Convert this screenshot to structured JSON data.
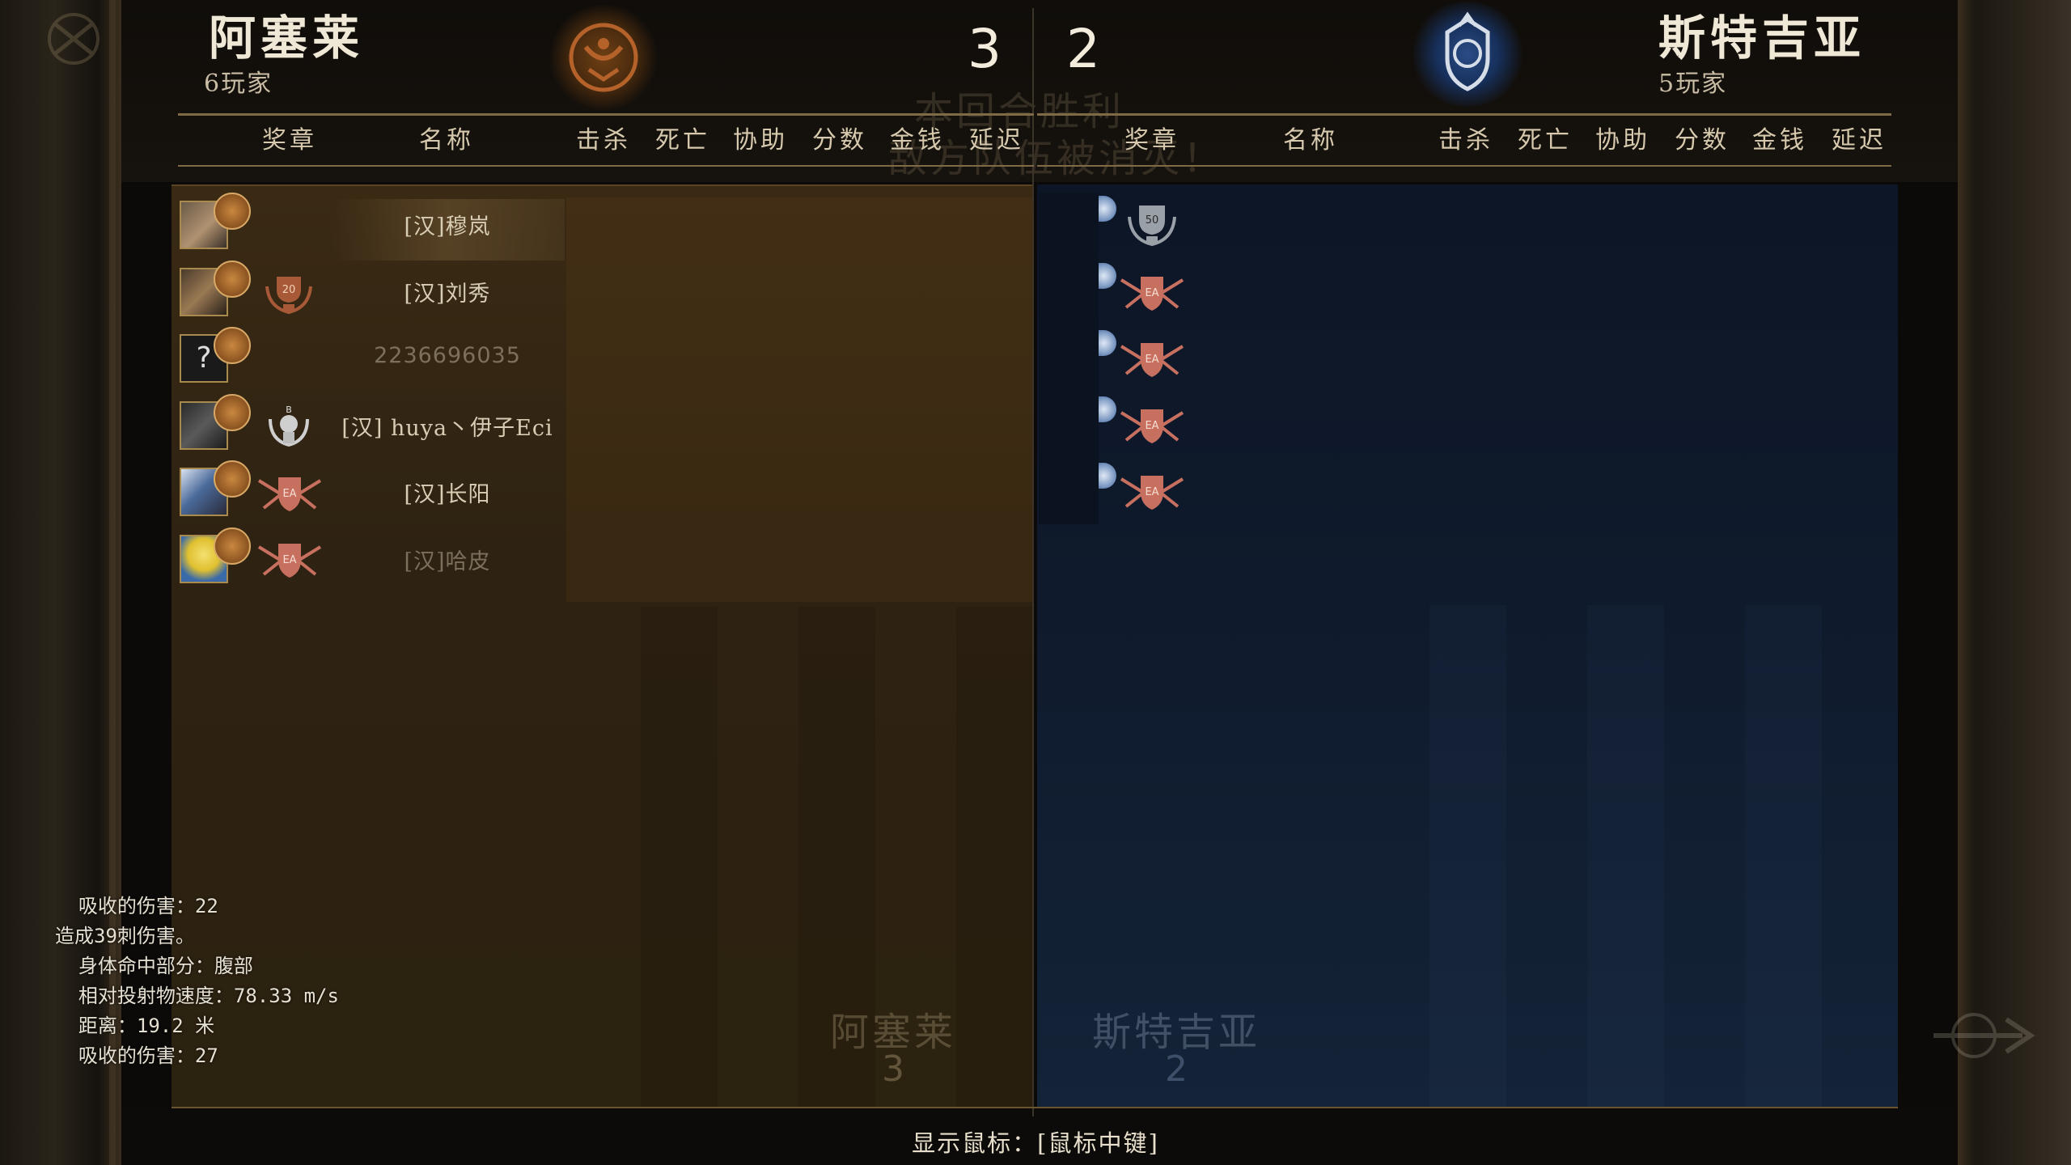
{
  "left_team": {
    "name": "阿塞莱",
    "player_count": "6玩家",
    "score": "3",
    "emblem": "sun-crest-icon",
    "color": "#6e3f14"
  },
  "right_team": {
    "name": "斯特吉亚",
    "player_count": "5玩家",
    "score": "2",
    "emblem": "wolf-crest-icon",
    "color": "#2a4c86"
  },
  "columns_left": [
    "奖章",
    "名称",
    "击杀",
    "死亡",
    "协助",
    "分数",
    "金钱",
    "延迟"
  ],
  "columns_right": [
    "奖章",
    "名称",
    "击杀",
    "死亡",
    "协助",
    "分数",
    "金钱",
    "延迟"
  ],
  "ghost_round": {
    "line1": "本回合胜利",
    "line2": "敌方队伍被消灭！"
  },
  "left_players": [
    {
      "name": "[汉]穆岚",
      "medal": "",
      "dim": false,
      "highlight": true
    },
    {
      "name": "[汉]刘秀",
      "medal": "20",
      "dim": false
    },
    {
      "name": "2236696035",
      "medal": "",
      "dim": true
    },
    {
      "name": "[汉] huya丶伊子Eci",
      "medal": "B",
      "dim": false
    },
    {
      "name": "[汉]长阳",
      "medal": "EA",
      "dim": false
    },
    {
      "name": "[汉]哈皮",
      "medal": "EA",
      "dim": true
    }
  ],
  "right_players": [
    {
      "medal": "50"
    },
    {
      "medal": "EA"
    },
    {
      "medal": "EA"
    },
    {
      "medal": "EA"
    },
    {
      "medal": "EA"
    }
  ],
  "bottom_scores": {
    "left_name": "阿塞莱",
    "left_score": "3",
    "right_name": "斯特吉亚",
    "right_score": "2"
  },
  "combat_log": [
    "  吸收的伤害：22",
    "造成39刺伤害。",
    "  身体命中部分：腹部",
    "  相对投射物速度：78.33 m/s",
    "  距离：19.2 米",
    "  吸收的伤害：27"
  ],
  "footer_hint": "显示鼠标：[鼠标中键]"
}
